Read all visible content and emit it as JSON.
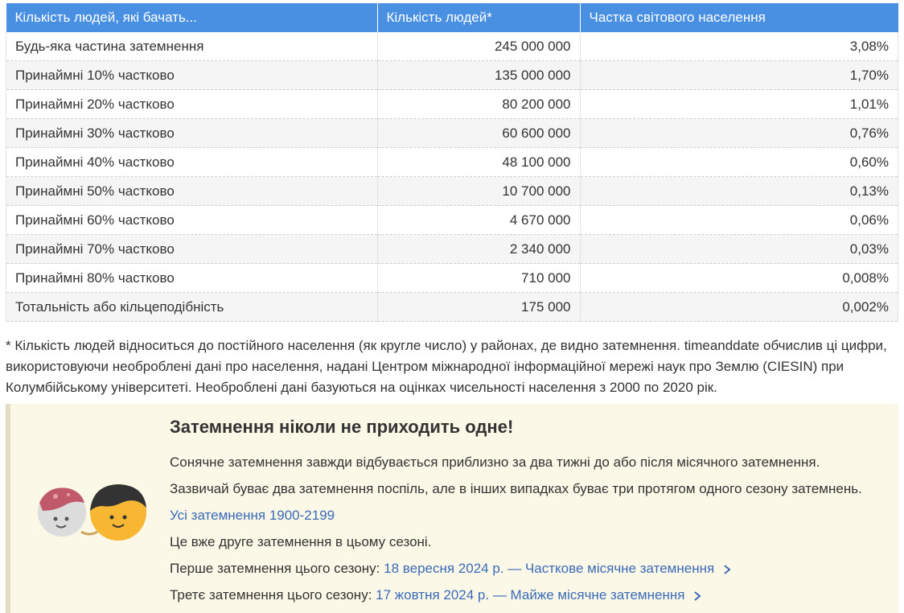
{
  "table": {
    "headers": [
      "Кількість людей, які бачать...",
      "Кількість людей*",
      "Частка світового населення"
    ],
    "rows": [
      [
        "Будь-яка частина затемнення",
        "245 000 000",
        "3,08%"
      ],
      [
        "Принаймні 10% частково",
        "135 000 000",
        "1,70%"
      ],
      [
        "Принаймні 20% частково",
        "80 200 000",
        "1,01%"
      ],
      [
        "Принаймні 30% частково",
        "60 600 000",
        "0,76%"
      ],
      [
        "Принаймні 40% частково",
        "48 100 000",
        "0,60%"
      ],
      [
        "Принаймні 50% частково",
        "10 700 000",
        "0,13%"
      ],
      [
        "Принаймні 60% частково",
        "4 670 000",
        "0,06%"
      ],
      [
        "Принаймні 70% частково",
        "2 340 000",
        "0,03%"
      ],
      [
        "Принаймні 80% частково",
        "710 000",
        "0,008%"
      ],
      [
        "Тотальність або кільцеподібність",
        "175 000",
        "0,002%"
      ]
    ]
  },
  "footnote": "* Кількість людей відноситься до постійного населення (як кругле число) у районах, де видно затемнення. timeanddate обчислив ці цифри, використовуючи необроблені дані про населення, надані Центром міжнародної інформаційної мережі наук про Землю (CIESIN) при Колумбійському університеті. Необроблені дані базуються на оцінках чисельності населення з 2000 по 2020 рік.",
  "card": {
    "title": "Затемнення ніколи не приходить одне!",
    "p1": "Сонячне затемнення завжди відбувається приблизно за два тижні до або після місячного затемнення.",
    "p2": "Зазвичай буває два затемнення поспіль, але в інших випадках буває три протягом одного сезону затемнень.",
    "all_link": "Усі затемнення 1900-2199",
    "p3": "Це вже друге затемнення в цьому сезоні.",
    "first_label": "Перше затемнення цього сезону:",
    "first_link": "18 вересня 2024 р. — Часткове місячне затемнення",
    "third_label": "Третє затемнення цього сезону:",
    "third_link": "17 жовтня 2024 р. — Майже місячне затемнення"
  },
  "icons": {
    "mascot": "moon-and-sun-mascot-icon",
    "chevron": "chevron-right-icon"
  },
  "colors": {
    "header_bg": "#4a90e2",
    "card_bg": "#fcf8e8",
    "link": "#3a6bb8",
    "sun": "#f7b733",
    "moon": "#d9d9d9"
  }
}
